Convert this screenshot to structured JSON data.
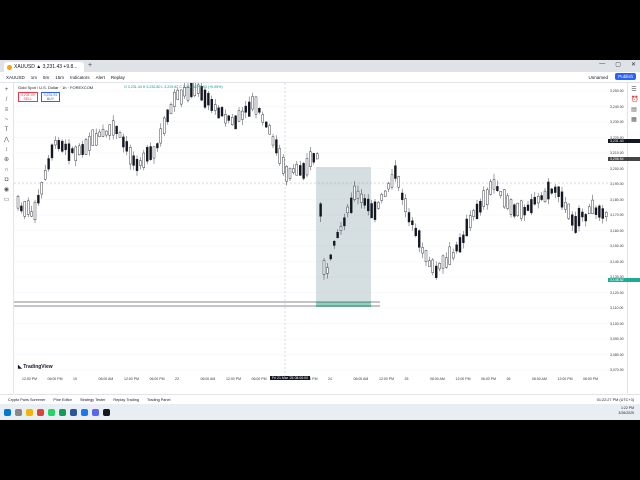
{
  "browser": {
    "tab_title": "XAUUSD ▲ 3,231.43 +9.8...",
    "newtab_label": "+",
    "window_controls": [
      "—",
      "▢",
      "✕"
    ]
  },
  "toolbar": {
    "symbol": "XAUUSD",
    "timeframes": [
      "1m",
      "5m",
      "15m"
    ],
    "indicators_label": "Indicators",
    "alert_label": "Alert",
    "replay_label": "Replay",
    "layout_label": "Unnamed",
    "publish_label": "Publish"
  },
  "legend": {
    "title": "Gold Spot / U.S. Dollar · 1h · FOREXCOM",
    "ohlc": "O 3,231.44  H 3,232.80  L 3,229.62  C 3,231.43  +1.53 (+0.05%)",
    "bid": "3,231.03",
    "bid_label": "SELL",
    "ask": "3,231.91",
    "ask_label": "BUY"
  },
  "price_axis": {
    "labels": [
      "3,250.00",
      "3,240.00",
      "3,230.00",
      "3,220.00",
      "3,210.00",
      "3,200.00",
      "3,190.00",
      "3,180.00",
      "3,170.00",
      "3,160.00",
      "3,150.00",
      "3,140.00",
      "3,130.00",
      "3,120.00",
      "3,110.00",
      "3,100.00",
      "3,090.00",
      "3,080.00",
      "3,070.00"
    ],
    "current_price": "3,231.43",
    "crosshair_price": "3,208.54",
    "zone_price": "3,148.52"
  },
  "time_axis": {
    "labels": [
      "12:00 PM",
      "06:00 PM",
      "19",
      "06:00 AM",
      "12:00 PM",
      "06:00 PM",
      "22",
      "06:00 AM",
      "12:00 PM",
      "06:00 PM",
      "23",
      "06:00 PM",
      "24",
      "06:00 AM",
      "12:00 PM",
      "25",
      "06:00 AM",
      "12:00 PM",
      "06:00 PM",
      "26",
      "06:00 AM",
      "12:00 PM",
      "06:00 PM"
    ],
    "cursor_time": "Fri 21 Mar '25  08:00:00"
  },
  "tv_logo": "TradingView",
  "panel_tabs": [
    "Crypto Pairs Screener",
    "Pine Editor",
    "Strategy Tester",
    "Replay Trading",
    "Trading Panel"
  ],
  "status_time": "01:22:27 PM (UTC+3)",
  "tray": {
    "time": "1:22 PM",
    "date": "3/26/2025",
    "lang": "ENG"
  },
  "colors": {
    "up": "#131722",
    "down": "#ffffff",
    "zone": "#b2c2c6",
    "tp_zone": "#8fd3bc",
    "accent": "#2962ff"
  }
}
